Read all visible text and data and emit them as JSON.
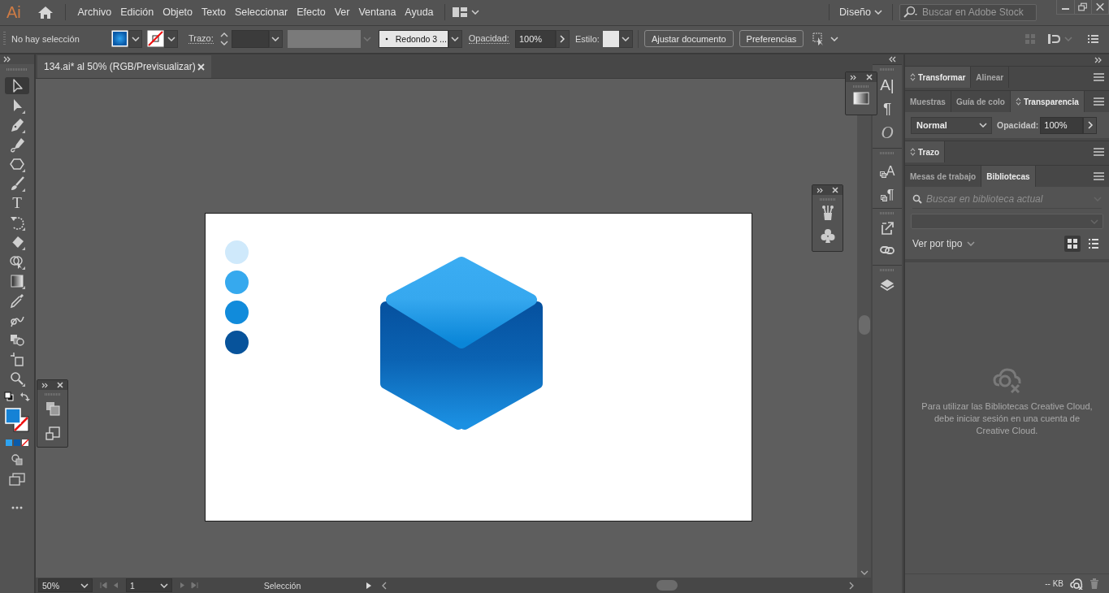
{
  "app": {
    "logo": "Ai"
  },
  "menu": [
    "Archivo",
    "Edición",
    "Objeto",
    "Texto",
    "Seleccionar",
    "Efecto",
    "Ver",
    "Ventana",
    "Ayuda"
  ],
  "workspace": "Diseño",
  "stock_search": {
    "placeholder": "Buscar en Adobe Stock"
  },
  "control_bar": {
    "selection": "No hay selección",
    "stroke_label": "Trazo:",
    "brush": "Redondo 3 ...",
    "opacity_label": "Opacidad:",
    "opacity": "100%",
    "style_label": "Estilo:",
    "buttons": [
      "Ajustar documento",
      "Preferencias"
    ]
  },
  "document_tab": {
    "title": "134.ai* al 50% (RGB/Previsualizar)"
  },
  "tools": [
    {
      "kind": "selection",
      "selected": true
    },
    {
      "kind": "direct-selection",
      "selected": false
    },
    {
      "kind": "pen",
      "selected": false
    },
    {
      "kind": "curvature",
      "selected": false
    },
    {
      "kind": "polygon",
      "selected": false
    },
    {
      "kind": "brush",
      "selected": false
    },
    {
      "kind": "type",
      "glyph": "T",
      "selected": false
    },
    {
      "kind": "rotate",
      "selected": false
    },
    {
      "kind": "eraser",
      "selected": false
    },
    {
      "kind": "shape-builder",
      "selected": false
    },
    {
      "kind": "gradient",
      "selected": false
    },
    {
      "kind": "eyedropper",
      "selected": false
    },
    {
      "kind": "blend",
      "selected": false
    },
    {
      "kind": "symbols",
      "selected": false
    },
    {
      "kind": "artboard",
      "selected": false
    },
    {
      "kind": "zoom",
      "selected": false
    }
  ],
  "dock": [
    {
      "kind": "glyph",
      "text": "A|"
    },
    {
      "kind": "glyph",
      "text": "¶"
    },
    {
      "kind": "italic",
      "text": "O"
    },
    {
      "kind": "styles",
      "text": "A"
    },
    {
      "kind": "styles",
      "text": "¶"
    },
    {
      "kind": "export"
    },
    {
      "kind": "links"
    },
    {
      "kind": "layers"
    }
  ],
  "panels": [
    {
      "tabs": [
        {
          "label": "Transformar",
          "selected": true,
          "expandable": true
        },
        {
          "label": "Alinear",
          "selected": false,
          "expandable": false
        }
      ]
    },
    {
      "tabs": [
        {
          "label": "Muestras",
          "selected": false,
          "expandable": false
        },
        {
          "label": "Guía de colo",
          "selected": false,
          "expandable": false
        },
        {
          "label": "Transparencia",
          "selected": true,
          "expandable": true
        }
      ],
      "content": {
        "kind": "transparency",
        "blend_mode": "Normal",
        "opacity_label": "Opacidad:",
        "opacity": "100%"
      }
    },
    {
      "tabs": [
        {
          "label": "Trazo",
          "selected": true,
          "expandable": true
        }
      ]
    },
    {
      "tabs": [
        {
          "label": "Mesas de trabajo",
          "selected": false,
          "expandable": false
        },
        {
          "label": "Bibliotecas",
          "selected": true,
          "expandable": false
        }
      ],
      "content": {
        "kind": "libraries",
        "search_placeholder": "Buscar en biblioteca actual",
        "view_label": "Ver por tipo",
        "views": [
          {
            "kind": "grid",
            "selected": true
          },
          {
            "kind": "list",
            "selected": false
          }
        ],
        "message": "Para utilizar las Bibliotecas Creative Cloud, debe iniciar sesión en una cuenta de Creative Cloud.",
        "size": "-- KB"
      }
    }
  ],
  "status_bar": {
    "zoom": "50%",
    "artboard": "1",
    "tool": "Selección"
  },
  "artboard": {
    "swatches": [
      {
        "color": "#cfe9fb"
      },
      {
        "color": "#36a9ee"
      },
      {
        "color": "#118bdb"
      },
      {
        "color": "#07539b"
      }
    ]
  }
}
